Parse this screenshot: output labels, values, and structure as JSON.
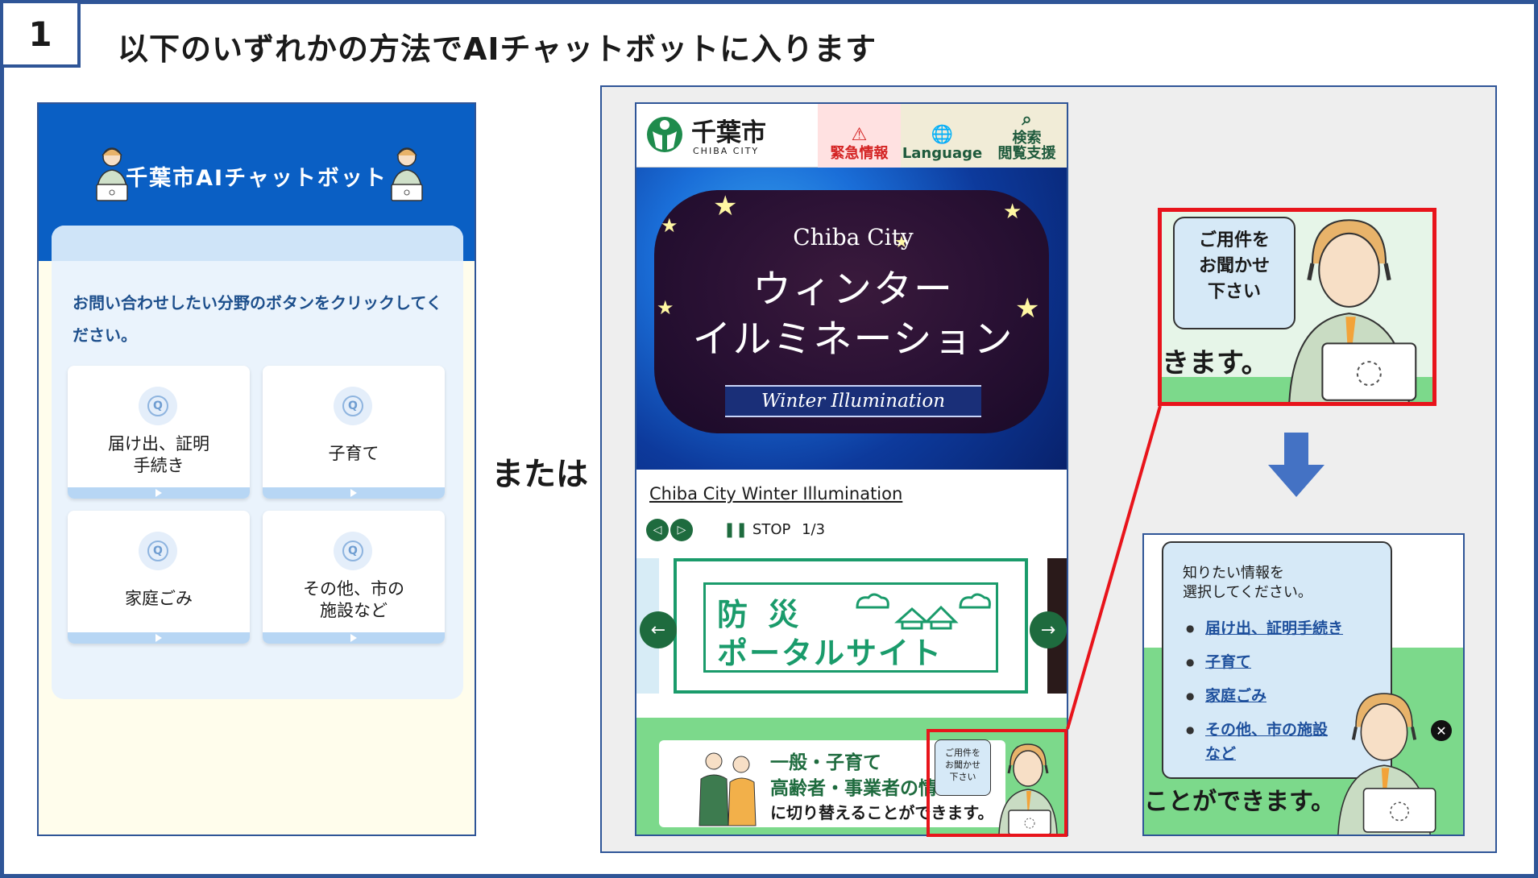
{
  "slide": {
    "step_number": "1",
    "title": "以下のいずれかの方法でAIチャットボットに入ります",
    "or_label": "または"
  },
  "chatbot": {
    "title": "千葉市AIチャットボット",
    "instruction": "お問い合わせしたい分野のボタンをクリックしてください。",
    "categories": [
      {
        "label": "届け出、証明\n手続き",
        "icon": "q-bubble-icon"
      },
      {
        "label": "子育て",
        "icon": "q-bubble-icon"
      },
      {
        "label": "家庭ごみ",
        "icon": "q-bubble-icon"
      },
      {
        "label": "その他、市の\n施設など",
        "icon": "q-bubble-icon"
      }
    ]
  },
  "site": {
    "logo_text": "千葉市",
    "logo_text_en": "CHIBA CITY",
    "nav": {
      "emergency": "緊急情報",
      "language": "Language",
      "search": "検索\n閲覧支援"
    },
    "banner": {
      "title_en": "Chiba City",
      "title_jp_line1": "ウィンター",
      "title_jp_line2": "イルミネーション",
      "ribbon": "Winter Illumination"
    },
    "banner_caption": "Chiba City Winter Illumination",
    "slider": {
      "stop_label": "STOP",
      "page_indicator": "1/3"
    },
    "disaster_portal": {
      "line1": "防 災",
      "line2": "ポータルサイト"
    },
    "info_section": {
      "line1": "一般・子育て",
      "line2": "高齢者・事業者の情",
      "line3": "に切り替えることができます。"
    },
    "bot_bubble": "ご用件を\nお聞かせ\n下さい"
  },
  "zoom_before": {
    "bubble": "ご用件を\nお聞かせ\n下さい",
    "background_text": "きます。"
  },
  "zoom_after": {
    "prompt": "知りたい情報を\n選択してください。",
    "links": [
      "届け出、証明手続き",
      "子育て",
      "家庭ごみ",
      "その他、市の施設",
      "など"
    ],
    "background_text": "ことができます。"
  },
  "colors": {
    "border_blue": "#2f5597",
    "chat_header": "#0a5fc4",
    "highlight_red": "#e8141b",
    "arrow_blue": "#4472c4",
    "site_green": "#1e6b3e"
  }
}
